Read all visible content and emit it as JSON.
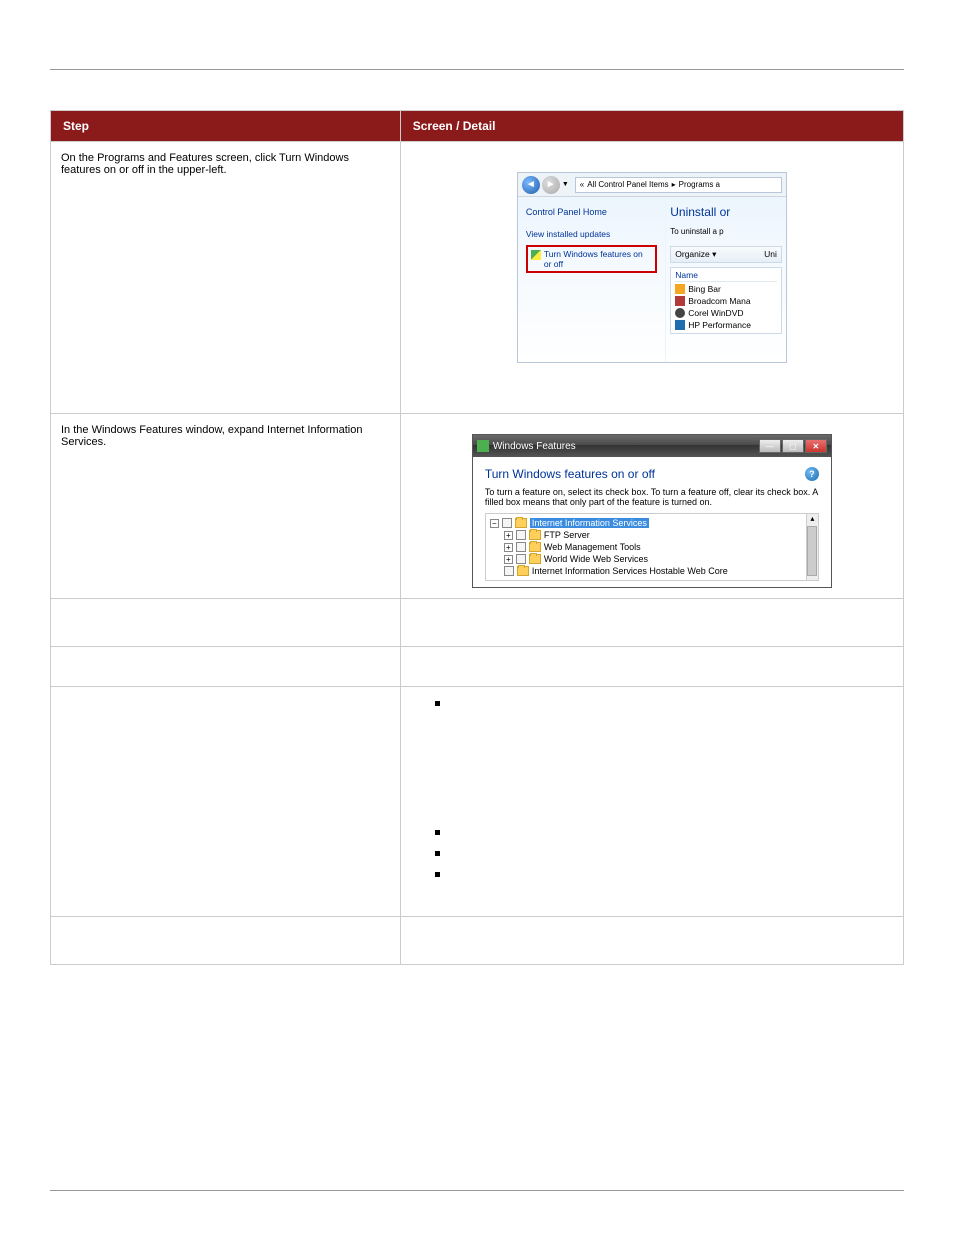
{
  "header": {
    "left": "",
    "right": ""
  },
  "tableHeader": {
    "left": "Step",
    "right": "Screen / Detail"
  },
  "row1": {
    "leftText": "On the Programs and Features screen, click Turn Windows features on or off in the upper-left.",
    "breadcrumb": {
      "prefix": "«",
      "seg1": "All Control Panel Items",
      "seg2": "Programs a"
    },
    "sideTitle": "Control Panel Home",
    "sideLink1": "View installed updates",
    "sideLink2": "Turn Windows features on or off",
    "mainHeading": "Uninstall or",
    "mainSub": "To uninstall a p",
    "organize": "Organize ▾",
    "uni": "Uni",
    "colName": "Name",
    "programs": {
      "p1": "Bing Bar",
      "p2": "Broadcom Mana",
      "p3": "Corel WinDVD",
      "p4": "HP Performance"
    }
  },
  "row2": {
    "leftText": "In the Windows Features window, expand Internet Information Services.",
    "titlebar": "Windows Features",
    "dlgTitle": "Turn Windows features on or off",
    "dlgDesc": "To turn a feature on, select its check box. To turn a feature off, clear its check box. A filled box means that only part of the feature is turned on.",
    "tree": {
      "t0": "Internet Information Services",
      "t1": "FTP Server",
      "t2": "Web Management Tools",
      "t3": "World Wide Web Services",
      "t4": "Internet Information Services Hostable Web Core"
    }
  },
  "row3": {
    "left": "",
    "right": ""
  },
  "row4": {
    "left": "",
    "right": ""
  },
  "row5": {
    "leftText": "",
    "bullets": {
      "b1": "",
      "b2": "",
      "b3": "",
      "b4": ""
    }
  },
  "row6": {
    "left": "",
    "right": ""
  },
  "footer": {
    "left": "",
    "right": ""
  }
}
